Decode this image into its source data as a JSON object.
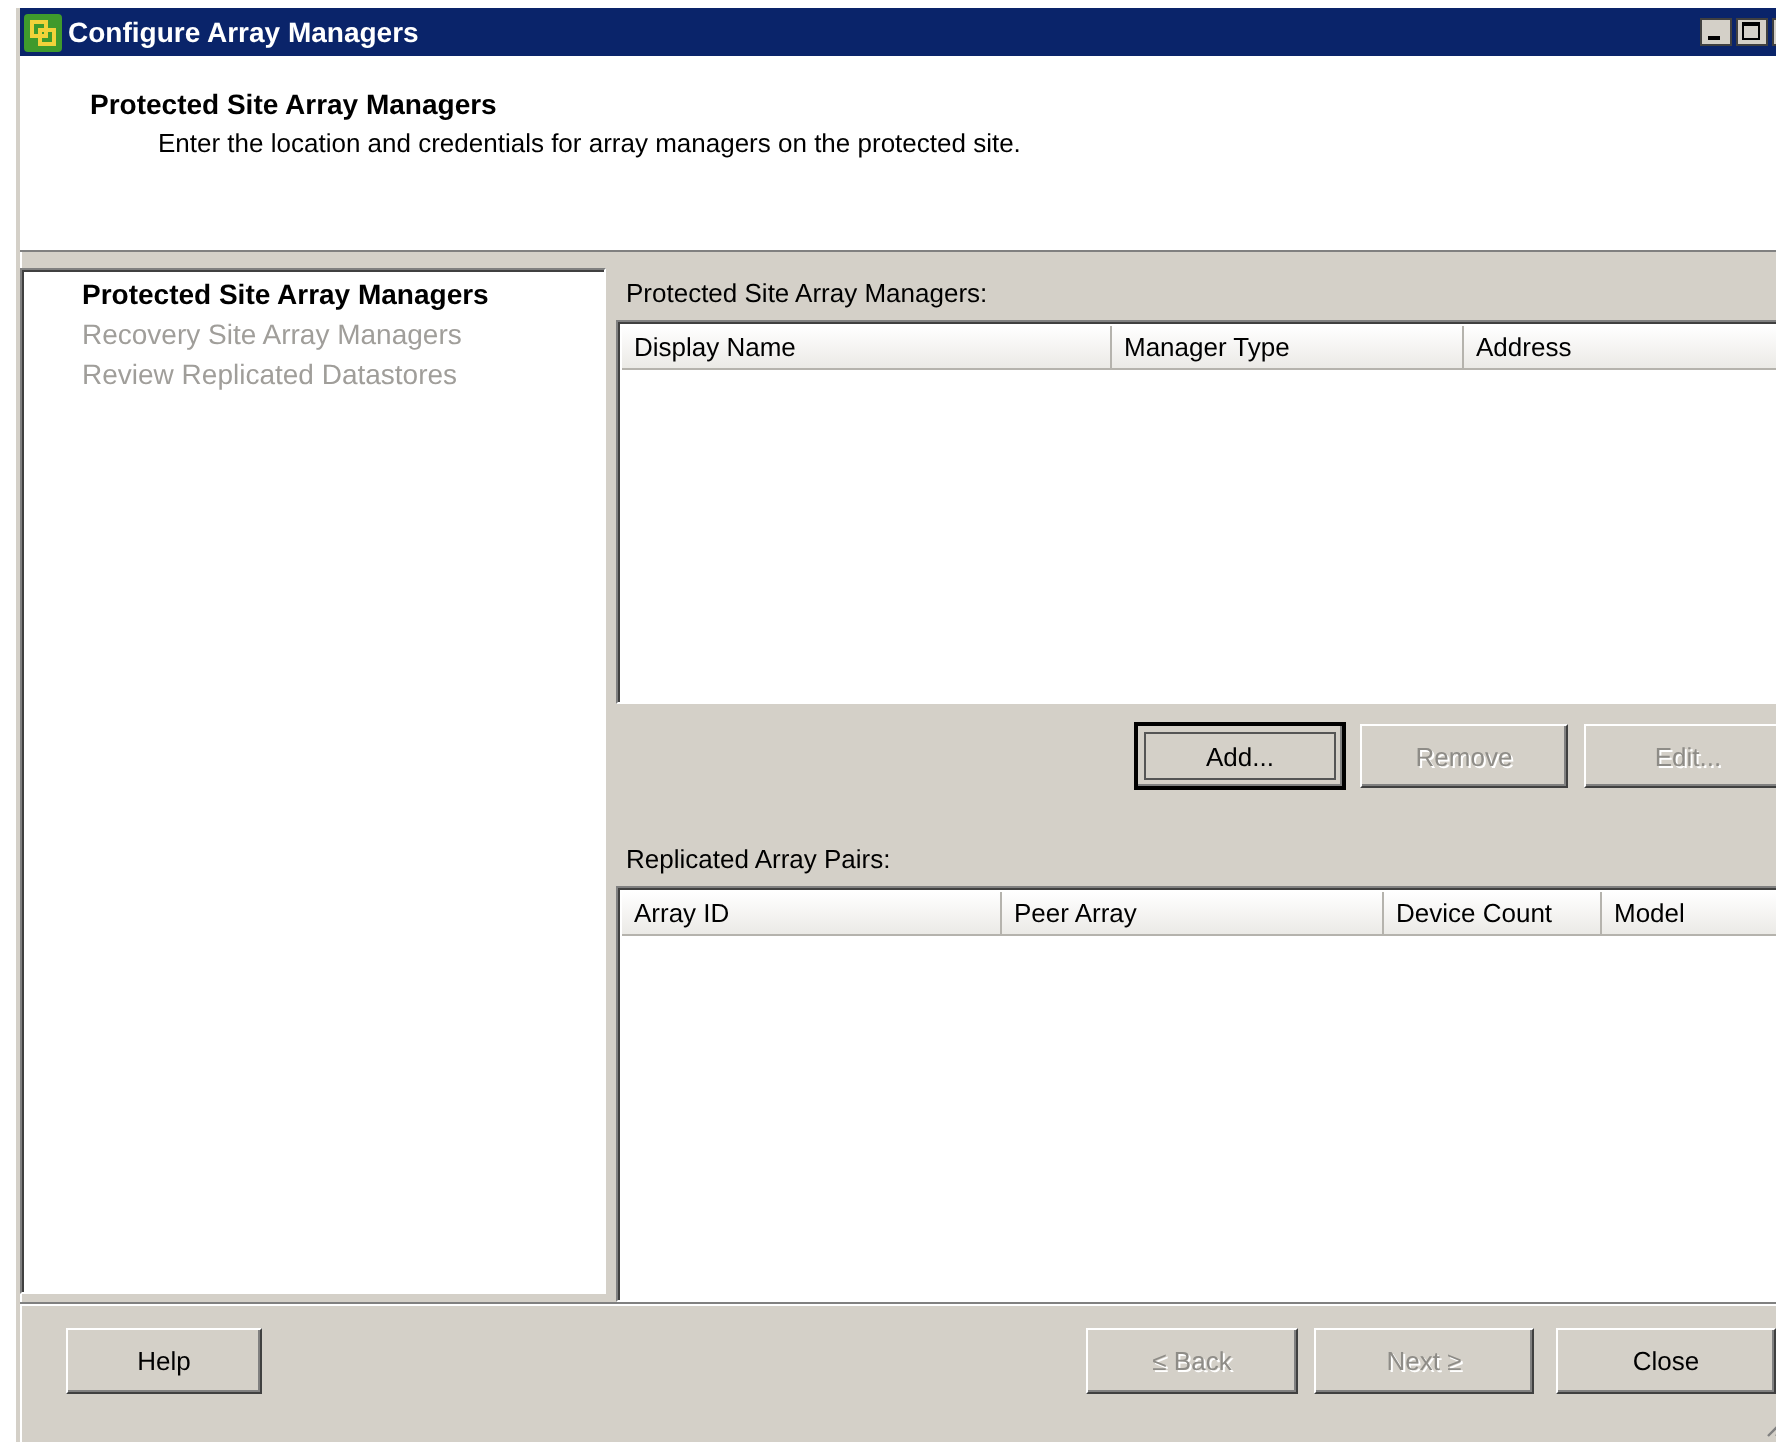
{
  "window": {
    "title": "Configure Array Managers"
  },
  "header": {
    "title": "Protected Site Array Managers",
    "description": "Enter the location and credentials for array managers on the protected site."
  },
  "steps": [
    {
      "label": "Protected Site Array Managers",
      "selected": true
    },
    {
      "label": "Recovery Site Array Managers",
      "selected": false
    },
    {
      "label": "Review Replicated Datastores",
      "selected": false
    }
  ],
  "managers": {
    "label": "Protected Site Array Managers:",
    "columns": [
      "Display Name",
      "Manager Type",
      "Address"
    ]
  },
  "manager_buttons": [
    {
      "label": "Add...",
      "disabled": false,
      "focused": true
    },
    {
      "label": "Remove",
      "disabled": true,
      "focused": false
    },
    {
      "label": "Edit...",
      "disabled": true,
      "focused": false
    }
  ],
  "pairs": {
    "label": "Replicated Array Pairs:",
    "columns": [
      "Array ID",
      "Peer Array",
      "Device Count",
      "Model"
    ]
  },
  "footer_buttons": [
    {
      "label": "Help",
      "disabled": false,
      "focused": false
    },
    {
      "label": "≤ Back",
      "disabled": true,
      "focused": false
    },
    {
      "label": "Next ≥",
      "disabled": true,
      "focused": false
    },
    {
      "label": "Close",
      "disabled": false,
      "focused": false
    }
  ]
}
